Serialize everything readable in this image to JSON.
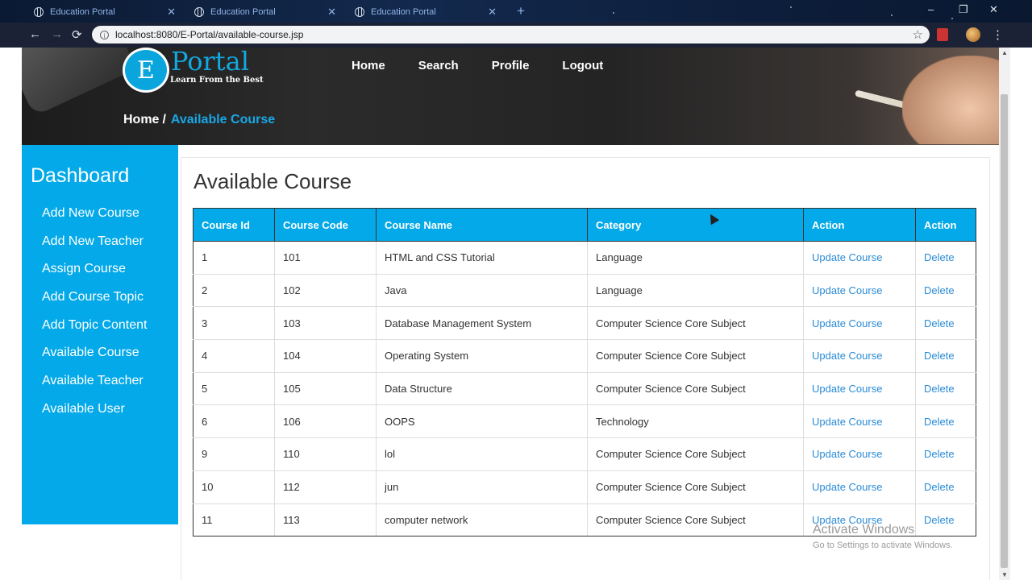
{
  "browser": {
    "tabs": [
      {
        "title": "Education Portal"
      },
      {
        "title": "Education Portal"
      },
      {
        "title": "Education Portal"
      }
    ],
    "new_tab_icon": "+",
    "url": "localhost:8080/E-Portal/available-course.jsp",
    "window_controls": {
      "minimize": "–",
      "maximize": "❐",
      "close": "✕"
    },
    "nav": {
      "back": "←",
      "forward": "→",
      "reload": "⟳"
    },
    "bookmark_icon": "☆",
    "menu_icon": "⋮"
  },
  "logo": {
    "letter": "E",
    "word": "Portal",
    "tagline": "Learn From the Best"
  },
  "topnav": {
    "home": "Home",
    "search": "Search",
    "profile": "Profile",
    "logout": "Logout"
  },
  "breadcrumb": {
    "home": "Home",
    "separator": "/",
    "current": "Available Course"
  },
  "sidebar": {
    "title": "Dashboard",
    "items": [
      {
        "label": "Add New Course"
      },
      {
        "label": "Add New Teacher"
      },
      {
        "label": "Assign Course"
      },
      {
        "label": "Add Course Topic"
      },
      {
        "label": "Add Topic Content"
      },
      {
        "label": "Available Course"
      },
      {
        "label": "Available Teacher"
      },
      {
        "label": "Available User"
      }
    ]
  },
  "main": {
    "title": "Available Course",
    "table": {
      "headers": [
        "Course Id",
        "Course Code",
        "Course Name",
        "Category",
        "Action",
        "Action"
      ],
      "rows": [
        {
          "id": "1",
          "code": "101",
          "name": "HTML and CSS Tutorial",
          "category": "Language",
          "update": "Update Course",
          "delete": "Delete"
        },
        {
          "id": "2",
          "code": "102",
          "name": "Java",
          "category": "Language",
          "update": "Update Course",
          "delete": "Delete"
        },
        {
          "id": "3",
          "code": "103",
          "name": "Database Management System",
          "category": "Computer Science Core Subject",
          "update": "Update Course",
          "delete": "Delete"
        },
        {
          "id": "4",
          "code": "104",
          "name": "Operating System",
          "category": "Computer Science Core Subject",
          "update": "Update Course",
          "delete": "Delete"
        },
        {
          "id": "5",
          "code": "105",
          "name": "Data Structure",
          "category": "Computer Science Core Subject",
          "update": "Update Course",
          "delete": "Delete"
        },
        {
          "id": "6",
          "code": "106",
          "name": "OOPS",
          "category": "Technology",
          "update": "Update Course",
          "delete": "Delete"
        },
        {
          "id": "9",
          "code": "110",
          "name": "lol",
          "category": "Computer Science Core Subject",
          "update": "Update Course",
          "delete": "Delete"
        },
        {
          "id": "10",
          "code": "112",
          "name": "jun",
          "category": "Computer Science Core Subject",
          "update": "Update Course",
          "delete": "Delete"
        },
        {
          "id": "11",
          "code": "113",
          "name": "computer network",
          "category": "Computer Science Core Subject",
          "update": "Update Course",
          "delete": "Delete"
        }
      ]
    }
  },
  "watermark": {
    "line1": "Activate Windows",
    "line2": "Go to Settings to activate Windows."
  },
  "colors": {
    "accent": "#03a9e8",
    "link": "#2a8bd6",
    "hero": "#242424"
  }
}
